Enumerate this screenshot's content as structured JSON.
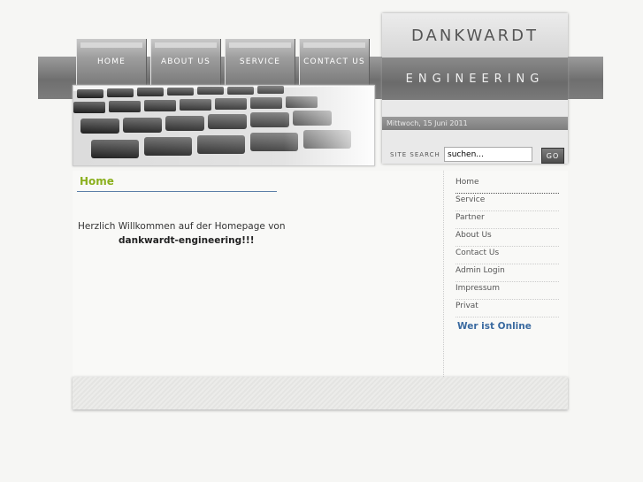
{
  "nav": {
    "tabs": [
      {
        "label": "HOME"
      },
      {
        "label": "ABOUT US"
      },
      {
        "label": "SERVICE"
      },
      {
        "label": "CONTACT US"
      }
    ]
  },
  "logo": {
    "line1": "DANKWARDT",
    "line2": "ENGINEERING"
  },
  "date": "Mittwoch, 15 Juni 2011",
  "search": {
    "label": "SITE SEARCH",
    "value": "suchen...",
    "button": "GO"
  },
  "main": {
    "title": "Home",
    "welcome": "Herzlich Willkommen auf der Homepage von",
    "welcome_bold": "dankwardt-engineering!!!"
  },
  "sidebar": {
    "items": [
      {
        "label": "Home"
      },
      {
        "label": "Service"
      },
      {
        "label": "Partner"
      },
      {
        "label": "About Us"
      },
      {
        "label": "Contact Us"
      },
      {
        "label": "Admin Login"
      },
      {
        "label": "Impressum"
      },
      {
        "label": "Privat"
      }
    ],
    "online_heading": "Wer ist Online"
  },
  "colors": {
    "title_green": "#8bb01e",
    "link_blue": "#3a6aa0"
  }
}
